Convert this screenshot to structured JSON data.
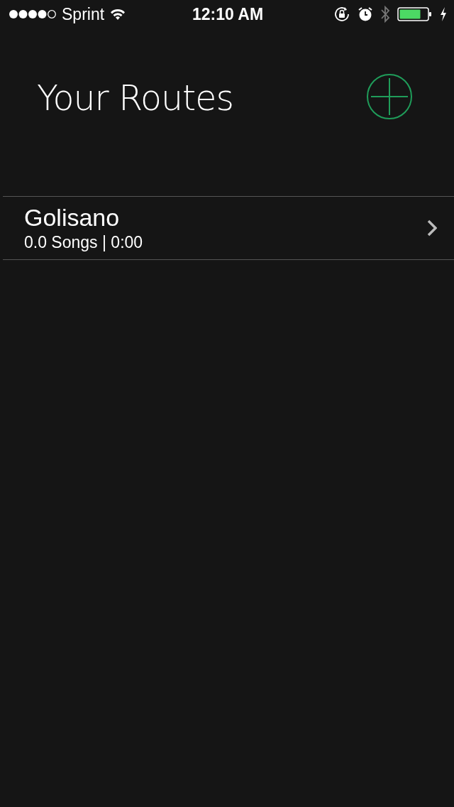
{
  "status_bar": {
    "carrier": "Sprint",
    "time": "12:10 AM"
  },
  "header": {
    "title": "Your Routes"
  },
  "routes": [
    {
      "name": "Golisano",
      "details": "0.0 Songs | 0:00"
    }
  ]
}
